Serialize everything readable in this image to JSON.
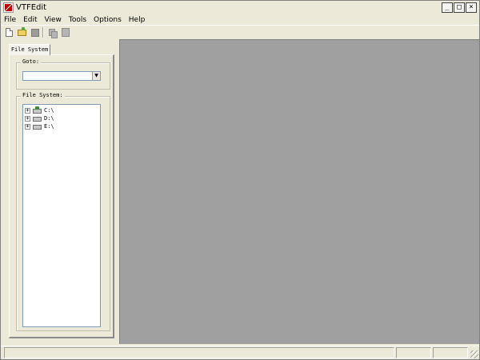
{
  "window": {
    "title": "VTFEdit",
    "controls": {
      "minimize": "_",
      "maximize": "□",
      "close": "×"
    }
  },
  "menu": {
    "items": [
      "File",
      "Edit",
      "View",
      "Tools",
      "Options",
      "Help"
    ]
  },
  "toolbar": {
    "icons": [
      "new-file-icon",
      "open-folder-icon",
      "save-icon",
      "copy-icon",
      "paste-icon"
    ]
  },
  "sidebar": {
    "tab_label": "File System",
    "goto": {
      "label": "Goto:",
      "value": "",
      "dropdown_glyph": "▼"
    },
    "file_system": {
      "label": "File System:",
      "expander_glyph": "+",
      "drives": [
        {
          "label": "C:\\",
          "icon": "system-drive-icon"
        },
        {
          "label": "D:\\",
          "icon": "drive-icon"
        },
        {
          "label": "E:\\",
          "icon": "drive-icon"
        }
      ]
    }
  },
  "statusbar": {
    "panes": [
      "",
      "",
      ""
    ]
  },
  "colors": {
    "main_background": "#a0a0a0",
    "chrome": "#ece9d8"
  }
}
